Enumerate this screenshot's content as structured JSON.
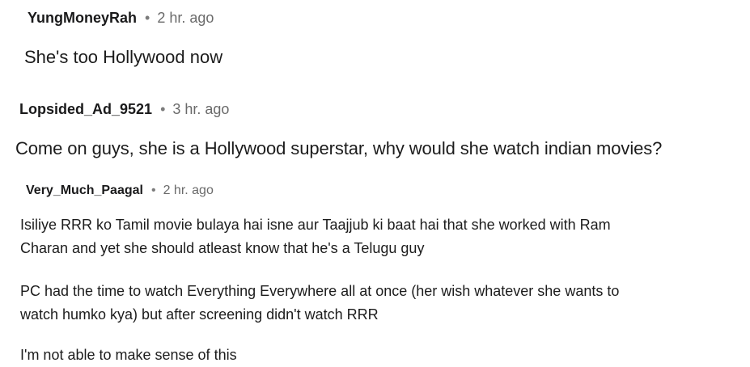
{
  "comments": [
    {
      "author": "YungMoneyRah",
      "separator": "•",
      "time": "2 hr. ago",
      "paragraphs": [
        "She's too Hollywood now"
      ]
    },
    {
      "author": "Lopsided_Ad_9521",
      "separator": "•",
      "time": "3 hr. ago",
      "paragraphs": [
        "Come on guys, she is a Hollywood superstar, why would she watch indian movies?"
      ]
    },
    {
      "author": "Very_Much_Paagal",
      "separator": "•",
      "time": "2 hr. ago",
      "paragraphs": [
        {
          "line1": "Isiliye RRR ko Tamil movie bulaya hai isne aur Taajjub ki baat hai that she worked with Ram",
          "line2": "Charan and yet she should atleast know that he's a Telugu guy"
        },
        {
          "line1": "PC had the time to watch Everything Everywhere all at once (her wish whatever she wants to",
          "line2": "watch humko kya) but after screening didn't watch RRR"
        },
        {
          "line1": "I'm not able to make sense of this"
        }
      ]
    }
  ]
}
